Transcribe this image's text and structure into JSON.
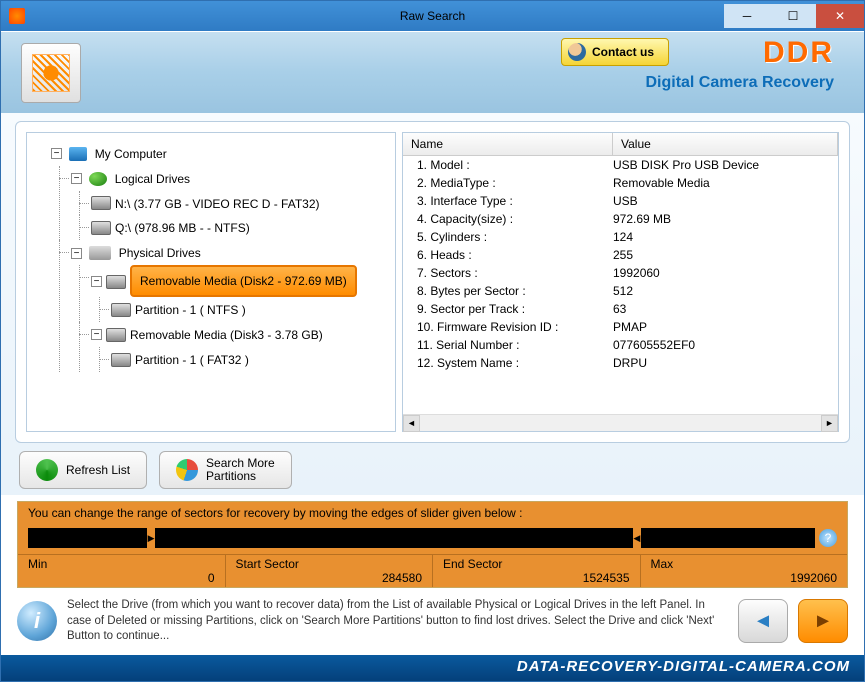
{
  "window": {
    "title": "Raw Search"
  },
  "header": {
    "contact_label": "Contact us",
    "brand": "DDR",
    "brand_sub": "Digital Camera Recovery"
  },
  "tree": {
    "root": "My Computer",
    "logical_label": "Logical Drives",
    "logical": [
      "N:\\ (3.77 GB - VIDEO REC D - FAT32)",
      "Q:\\ (978.96 MB -  - NTFS)"
    ],
    "physical_label": "Physical Drives",
    "physical": [
      {
        "label": "Removable Media (Disk2 - 972.69 MB)",
        "selected": true,
        "parts": [
          "Partition - 1 ( NTFS )"
        ]
      },
      {
        "label": "Removable Media (Disk3 - 3.78 GB)",
        "selected": false,
        "parts": [
          "Partition - 1 ( FAT32 )"
        ]
      }
    ]
  },
  "details": {
    "col_name": "Name",
    "col_value": "Value",
    "rows": [
      {
        "n": "1. Model :",
        "v": "USB DISK Pro USB Device"
      },
      {
        "n": "2. MediaType :",
        "v": "Removable Media"
      },
      {
        "n": "3. Interface Type :",
        "v": "USB"
      },
      {
        "n": "4. Capacity(size) :",
        "v": "972.69 MB"
      },
      {
        "n": "5. Cylinders :",
        "v": "124"
      },
      {
        "n": "6. Heads :",
        "v": "255"
      },
      {
        "n": "7. Sectors :",
        "v": "1992060"
      },
      {
        "n": "8. Bytes per Sector :",
        "v": "512"
      },
      {
        "n": "9. Sector per Track :",
        "v": "63"
      },
      {
        "n": "10. Firmware Revision ID :",
        "v": "PMAP"
      },
      {
        "n": "11. Serial Number :",
        "v": "077605552EF0"
      },
      {
        "n": "12. System Name :",
        "v": "DRPU"
      }
    ]
  },
  "actions": {
    "refresh": "Refresh List",
    "search_more": "Search More\nPartitions"
  },
  "slider": {
    "hint": "You can change the range of sectors for recovery by moving the edges of slider given below :",
    "min_label": "Min",
    "min": "0",
    "start_label": "Start Sector",
    "start": "284580",
    "end_label": "End Sector",
    "end": "1524535",
    "max_label": "Max",
    "max": "1992060"
  },
  "info": "Select the Drive (from which you want to recover data) from the List of available Physical or Logical Drives in the left Panel. In case of Deleted or missing Partitions, click on 'Search More Partitions' button to find lost drives. Select the Drive and click 'Next' Button to continue...",
  "footer": "DATA-RECOVERY-DIGITAL-CAMERA.COM"
}
